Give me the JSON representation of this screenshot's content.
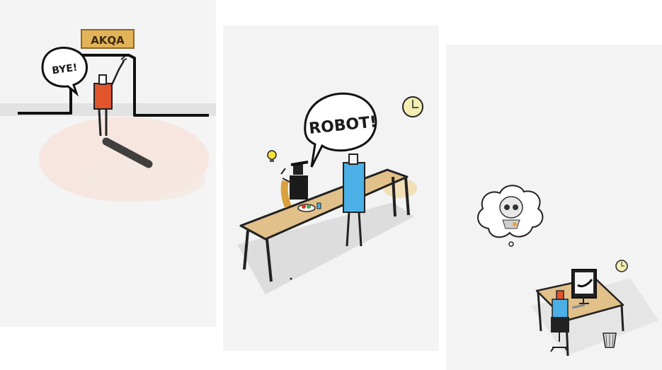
{
  "panels": [
    {
      "sign": "AKQA",
      "speech": "BYE!"
    },
    {
      "speech": "ROBOT!"
    },
    {}
  ],
  "colors": {
    "sign": "#e3b35a",
    "shirt_orange": "#e2542b",
    "shirt_blue": "#4ab0e6",
    "table": "#e1c08a",
    "clock_face": "#f4eeb3"
  }
}
